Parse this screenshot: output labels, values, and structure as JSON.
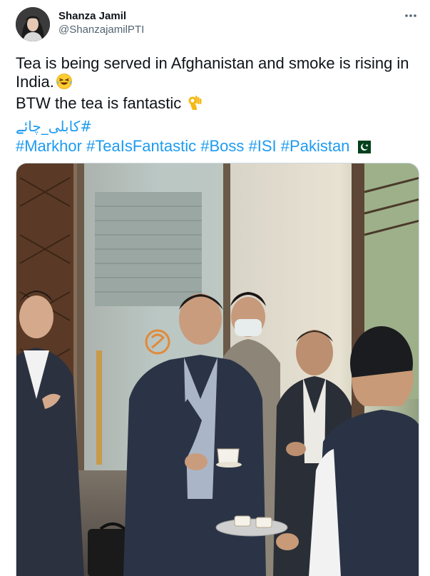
{
  "author": {
    "display_name": "Shanza Jamil",
    "handle": "@ShanzajamilPTI",
    "avatar_icon": "profile-photo"
  },
  "header": {
    "more_icon": "more-dots-icon"
  },
  "tweet": {
    "line1": "Tea is being served in Afghanistan and smoke is rising in India.",
    "line1_emoji": "😂",
    "line2": "BTW the tea is fantastic",
    "line2_emoji": "👌",
    "urdu_hashtag": "#کابلی_چائے",
    "hashtags": [
      "#Markhor",
      "#TeaIsFantastic",
      "#Boss",
      "#ISI",
      "#Pakistan"
    ],
    "flag_icon": "pakistan-flag-icon"
  },
  "media": {
    "description_icon": "photo"
  },
  "colors": {
    "text": "#0f1419",
    "secondary": "#536471",
    "link": "#1d9bf0",
    "border": "#cfd9de"
  }
}
